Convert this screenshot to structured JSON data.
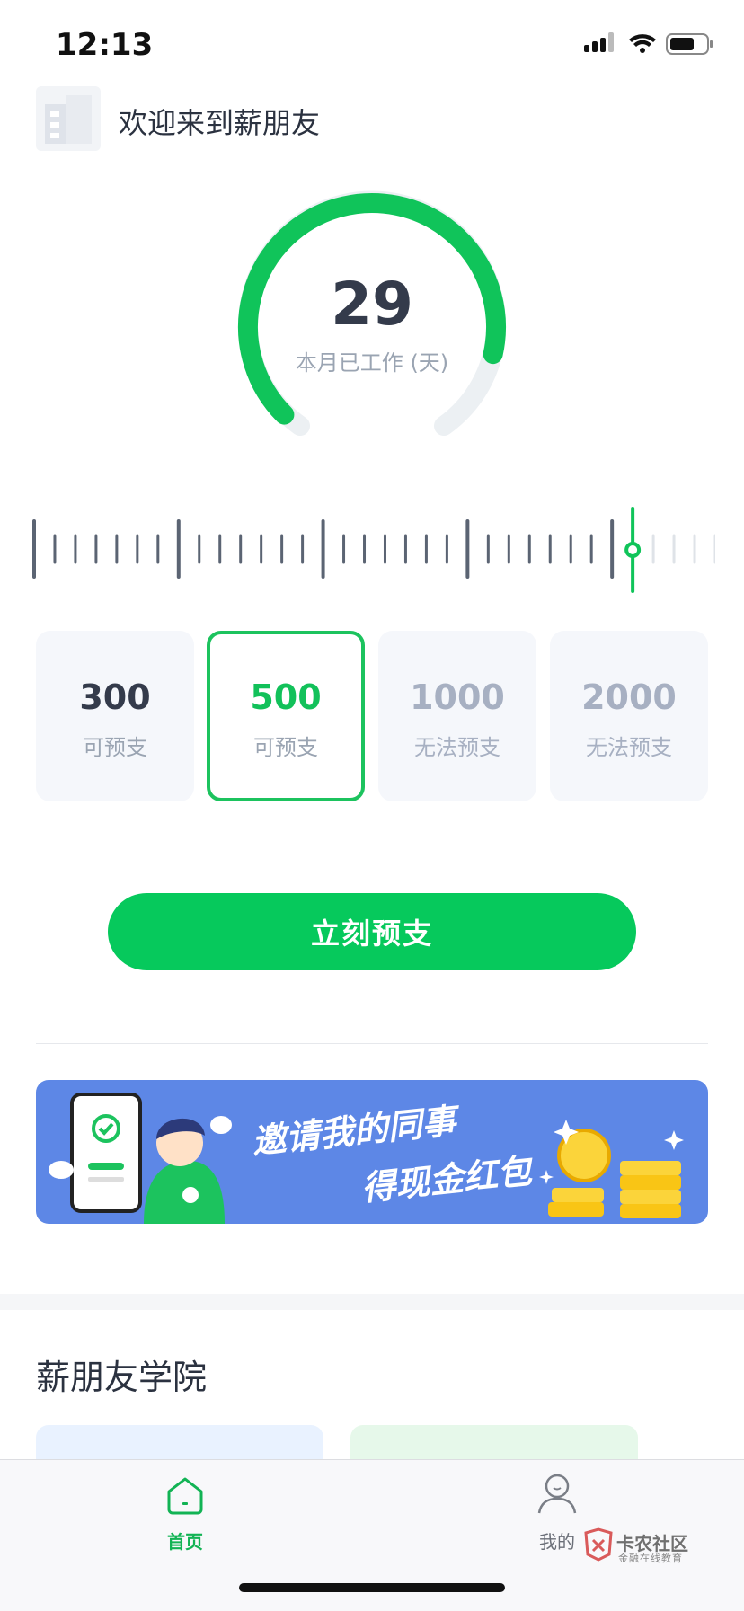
{
  "status_bar": {
    "time": "12:13"
  },
  "header": {
    "welcome": "欢迎来到薪朋友"
  },
  "gauge": {
    "days_worked": "29",
    "label": "本月已工作 (天)",
    "fraction": 0.88
  },
  "ruler": {
    "total_ticks": 34,
    "active_index": 28
  },
  "amounts": [
    {
      "value": "300",
      "status": "可预支",
      "state": "available"
    },
    {
      "value": "500",
      "status": "可预支",
      "state": "selected"
    },
    {
      "value": "1000",
      "status": "无法预支",
      "state": "disabled"
    },
    {
      "value": "2000",
      "status": "无法预支",
      "state": "disabled"
    }
  ],
  "advance_button": {
    "label": "立刻预支"
  },
  "banner": {
    "line1": "邀请我的同事",
    "line2": "得现金红包"
  },
  "academy": {
    "title": "薪朋友学院"
  },
  "tabs": [
    {
      "label": "首页",
      "active": true
    },
    {
      "label": "我的",
      "active": false
    }
  ],
  "watermark": {
    "title": "卡农社区",
    "subtitle": "金融在线教育"
  },
  "colors": {
    "accent": "#06c95c",
    "banner_bg": "#5d87e6"
  }
}
